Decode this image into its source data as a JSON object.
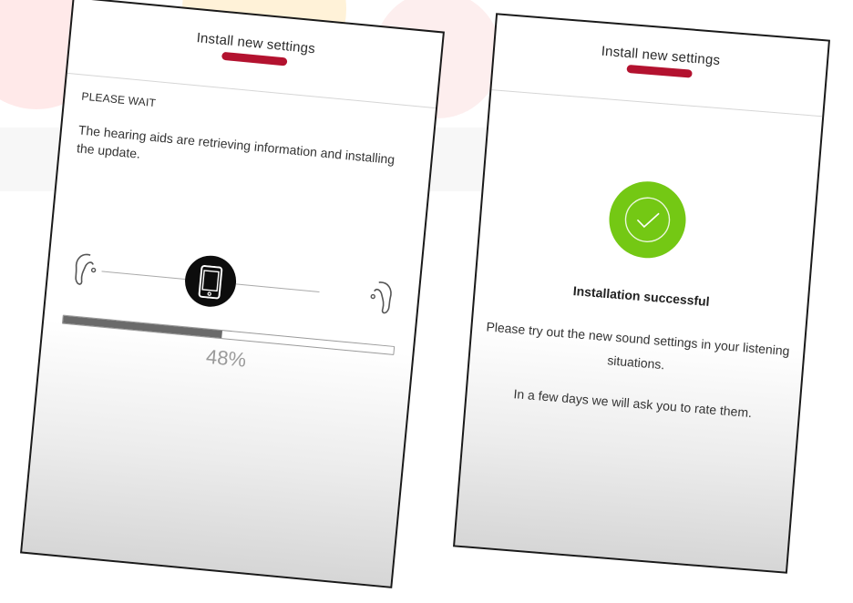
{
  "left_screen": {
    "header": {
      "title": "Install new settings"
    },
    "status_title": "PLEASE WAIT",
    "status_text": "The hearing aids are retrieving information and installing the update.",
    "progress": {
      "fraction": 0.48,
      "label": "48%"
    },
    "icons": {
      "left_device": "hearing-aid-icon",
      "center_device": "smartphone-icon",
      "right_device": "hearing-aid-icon"
    }
  },
  "right_screen": {
    "header": {
      "title": "Install new settings"
    },
    "success_icon": "checkmark-icon",
    "success_title": "Installation successful",
    "success_text": "Please try out the new sound settings in your listening situations.",
    "follow_up_text": "In a few days we will ask you to rate them."
  },
  "colors": {
    "accent_red": "#b3122f",
    "success_green": "#74c814",
    "progress_fill": "#6a6a6a"
  }
}
